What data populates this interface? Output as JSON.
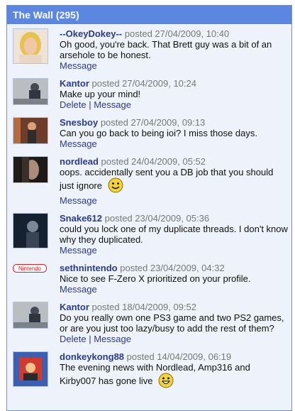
{
  "wall": {
    "title": "The Wall (295)",
    "posts": [
      {
        "user": "--OkeyDokey--",
        "posted": "posted 27/04/2009, 10:40",
        "text": "Oh good, you're back. That Brett guy was a bit of an arsehole to be honest.",
        "actions": [
          "Message"
        ]
      },
      {
        "user": "Kantor",
        "posted": "posted 27/04/2009, 10:24",
        "text": "Make up your mind!",
        "actions": [
          "Delete",
          "Message"
        ]
      },
      {
        "user": "Snesboy",
        "posted": "posted 27/04/2009, 09:13",
        "text": "Can you go back to being ioi? I miss those days.",
        "actions": [
          "Message"
        ]
      },
      {
        "user": "nordlead",
        "posted": "posted 24/04/2009, 05:52",
        "text": "oops. accidentally sent you a DB job that you should just ignore",
        "actions": [
          "Message"
        ]
      },
      {
        "user": "Snake612",
        "posted": "posted 23/04/2009, 05:36",
        "text": "could you lock one of my duplicate threads. I don't know why they duplicated.",
        "actions": [
          "Message"
        ]
      },
      {
        "user": "sethnintendo",
        "posted": "posted 23/04/2009, 04:32",
        "text": "Nice to see F-Zero X prioritized on your profile.",
        "actions": [
          "Message"
        ],
        "avatar_text": "Nintendo"
      },
      {
        "user": "Kantor",
        "posted": "posted 18/04/2009, 09:52",
        "text": "Do you really own one PS3 game and two PS2 games, or are you just too lazy/busy to add the rest of them?",
        "actions": [
          "Delete",
          "Message"
        ]
      },
      {
        "user": "donkeykong88",
        "posted": "posted 14/04/2009, 06:19",
        "text": "The evening news with Nordlead, Amp316 and Kirby007 has gone live",
        "actions": []
      }
    ]
  },
  "colors": {
    "header": "#5b87e0",
    "panel": "#eef2fa",
    "link": "#2c3a8c"
  }
}
